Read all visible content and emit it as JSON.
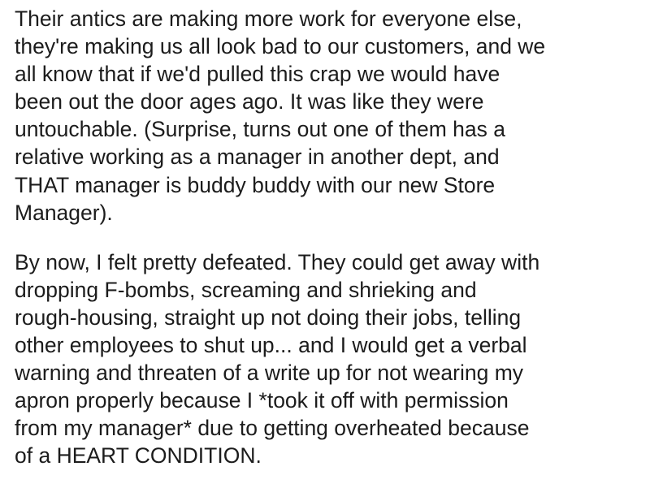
{
  "paragraphs": [
    {
      "lines": [
        "Their antics are making more work for everyone else,",
        "they're making us all look bad to our customers, and we",
        "all know that if we'd pulled this crap we would have",
        "been out the door ages ago. It was like they were",
        "untouchable. (Surprise, turns out one of them has a",
        "relative working as a manager in another dept, and",
        "THAT manager is buddy buddy with our new Store",
        "Manager)."
      ]
    },
    {
      "lines": [
        "By now, I felt pretty defeated. They could get away with",
        "dropping F-bombs, screaming and shrieking and",
        "rough-housing, straight up not doing their jobs, telling",
        "other employees to shut up... and I would get a verbal",
        "warning and threaten of a write up for not wearing my",
        "apron properly because I *took it off with permission",
        "from my manager* due to getting overheated because",
        "of a HEART CONDITION."
      ]
    }
  ]
}
